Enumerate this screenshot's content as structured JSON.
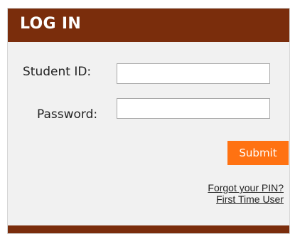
{
  "login": {
    "title": "LOG IN",
    "student_id_label": "Student ID:",
    "student_id_value": "",
    "password_label": "Password:",
    "password_value": "",
    "submit_label": "Submit",
    "forgot_link": "Forgot your PIN?",
    "first_time_link": "First Time User"
  },
  "colors": {
    "header": "#7a2d0c",
    "submit": "#ff7212",
    "panel_bg": "#f1f1f1"
  }
}
